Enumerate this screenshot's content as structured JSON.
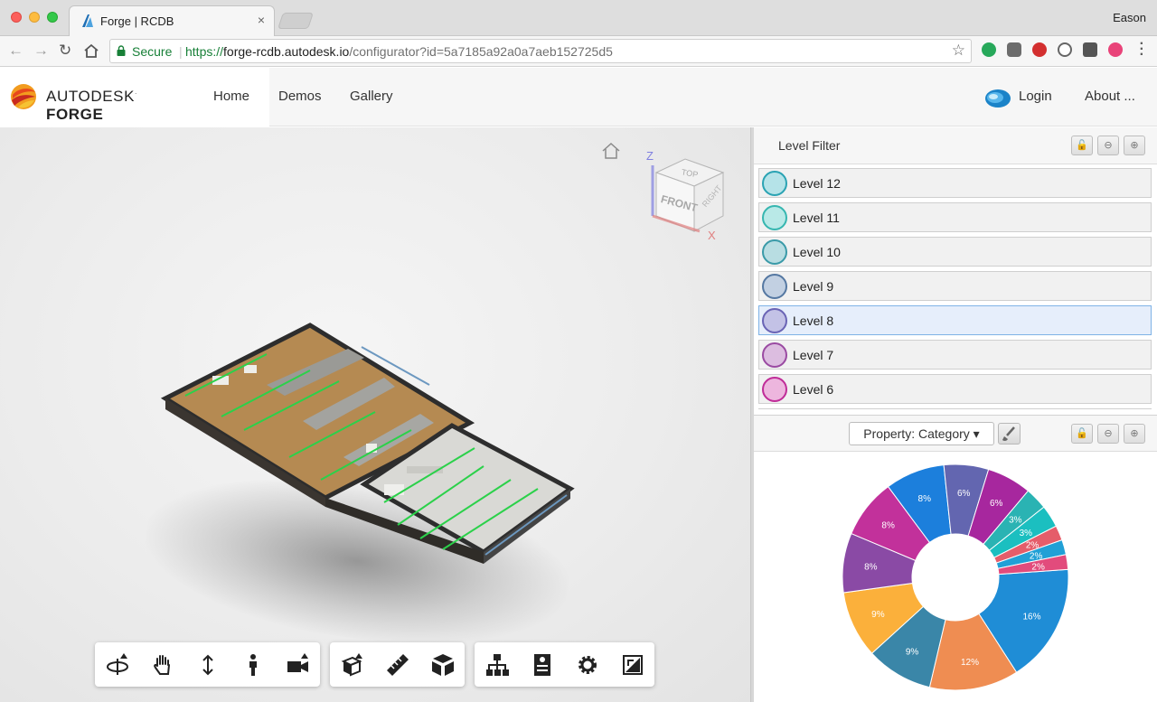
{
  "browser": {
    "tab_title": "Forge | RCDB",
    "tab_close": "×",
    "user_name": "Eason",
    "secure_label": "Secure",
    "url_scheme": "https://",
    "url_host": "forge-rcdb.autodesk.io",
    "url_rest": "/configurator?id=5a7185a92a0a7aeb152725d5"
  },
  "header": {
    "brand_prefix": "AUTODESK",
    "brand_suffix": "FORGE",
    "nav": [
      "Home",
      "Demos",
      "Gallery"
    ],
    "login": "Login",
    "about": "About ..."
  },
  "viewcube": {
    "top": "TOP",
    "front": "FRONT",
    "right": "RIGHT",
    "axis_z": "Z",
    "axis_x": "X"
  },
  "level_filter": {
    "title": "Level Filter",
    "levels": [
      {
        "label": "Level 12",
        "color": "#b5e3e8",
        "border": "#2aa3b3",
        "selected": false
      },
      {
        "label": "Level 11",
        "color": "#b9e9e7",
        "border": "#36b6b0",
        "selected": false
      },
      {
        "label": "Level 10",
        "color": "#b8dde2",
        "border": "#3a9aa8",
        "selected": false
      },
      {
        "label": "Level 9",
        "color": "#c2d0e2",
        "border": "#5578a2",
        "selected": false
      },
      {
        "label": "Level 8",
        "color": "#c3c2e6",
        "border": "#6a64b5",
        "selected": true
      },
      {
        "label": "Level 7",
        "color": "#dcbde0",
        "border": "#9a4aa2",
        "selected": false
      },
      {
        "label": "Level 6",
        "color": "#edb6de",
        "border": "#c02c98",
        "selected": false
      }
    ]
  },
  "pie_panel": {
    "property_label": "Property: Category ▾"
  },
  "chart_data": {
    "type": "pie",
    "donut": true,
    "title": "",
    "series": [
      {
        "label": "16%",
        "value": 16,
        "color": "#1f8dd6"
      },
      {
        "label": "12%",
        "value": 12,
        "color": "#ef8d52"
      },
      {
        "label": "9%",
        "value": 9,
        "color": "#3a86a8"
      },
      {
        "label": "9%",
        "value": 9,
        "color": "#fbb03b"
      },
      {
        "label": "8%",
        "value": 8,
        "color": "#8a4aa5"
      },
      {
        "label": "8%",
        "value": 8,
        "color": "#c2319b"
      },
      {
        "label": "8%",
        "value": 8,
        "color": "#1c7fdc"
      },
      {
        "label": "6%",
        "value": 6,
        "color": "#6366b0"
      },
      {
        "label": "6%",
        "value": 6,
        "color": "#a7279e"
      },
      {
        "label": "3%",
        "value": 3,
        "color": "#2ab3b3"
      },
      {
        "label": "3%",
        "value": 3,
        "color": "#1bbfc0"
      },
      {
        "label": "2%",
        "value": 2,
        "color": "#e55d6a"
      },
      {
        "label": "2%",
        "value": 2,
        "color": "#21a0d6"
      },
      {
        "label": "2%",
        "value": 2,
        "color": "#e24b7c"
      }
    ]
  }
}
